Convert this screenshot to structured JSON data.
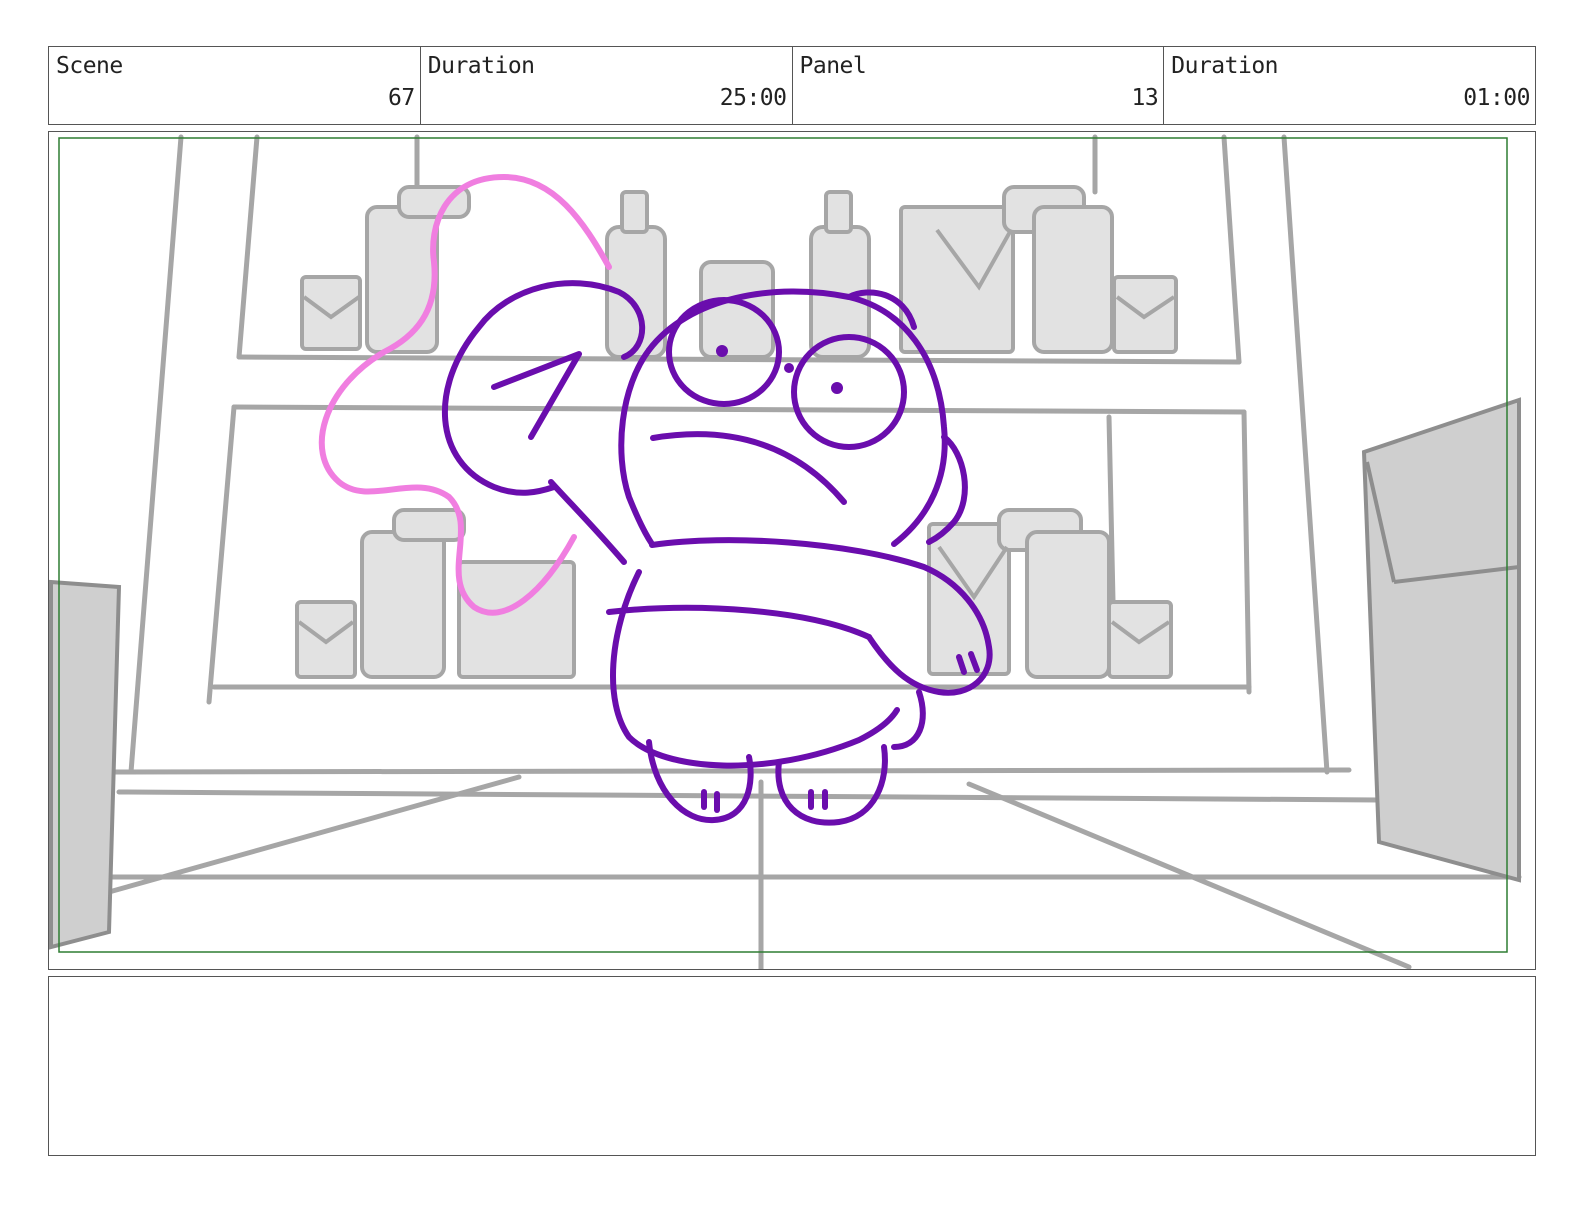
{
  "header": {
    "scene_label": "Scene",
    "scene_value": "67",
    "scene_duration_label": "Duration",
    "scene_duration_value": "25:00",
    "panel_label": "Panel",
    "panel_value": "13",
    "panel_duration_label": "Duration",
    "panel_duration_value": "01:00"
  },
  "colors": {
    "frame_border": "#555555",
    "safe_area": "#2e7d32",
    "background_lines": "#a6a6a6",
    "background_fill": "#e2e2e2",
    "character_line": "#6a0dad",
    "ear_line": "#f07ee0"
  },
  "notes": ""
}
